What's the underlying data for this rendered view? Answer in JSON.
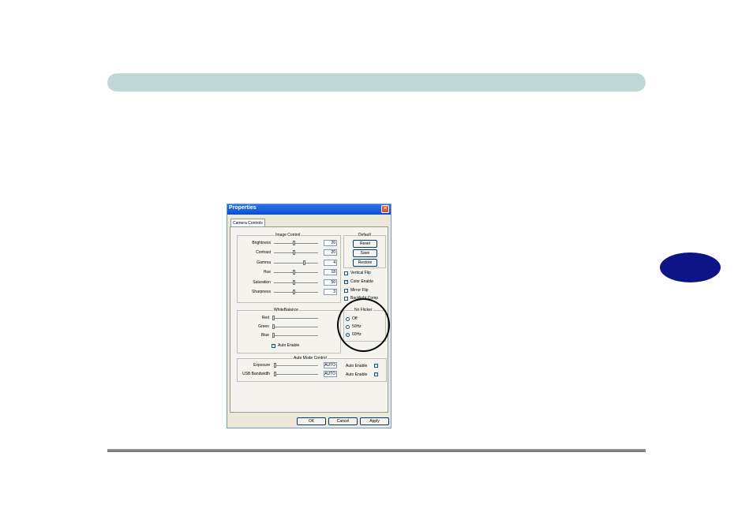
{
  "window": {
    "title": "Properties",
    "close_glyph": "✕"
  },
  "tab": {
    "label": "Camera Controls"
  },
  "image_control": {
    "title": "Image Control",
    "rows": [
      {
        "label": "Brightness",
        "value": "20",
        "level": 0.45
      },
      {
        "label": "Contrast",
        "value": "20",
        "level": 0.45
      },
      {
        "label": "Gamma",
        "value": "4",
        "level": 0.7
      },
      {
        "label": "Hue",
        "value": "18",
        "level": 0.45
      },
      {
        "label": "Saturation",
        "value": "50",
        "level": 0.45
      },
      {
        "label": "Sharpness",
        "value": "3",
        "level": 0.45
      }
    ]
  },
  "default": {
    "title": "Default",
    "reset": "Reset",
    "save": "Save",
    "restore": "Restore"
  },
  "checks": {
    "vertical_flip": {
      "label": "Vertical Flip",
      "checked": false
    },
    "color_enable": {
      "label": "Color Enable",
      "checked": true
    },
    "mirror_flip": {
      "label": "Mirror Flip",
      "checked": false
    },
    "backlight_comp": {
      "label": "Backlight Comp",
      "checked": false
    }
  },
  "white_balance": {
    "title": "WhiteBalance",
    "rows": [
      {
        "label": "Red",
        "level": 0.0
      },
      {
        "label": "Green",
        "level": 0.0
      },
      {
        "label": "Blue",
        "level": 0.0
      }
    ],
    "auto_enable": "Auto Enable"
  },
  "no_flicker": {
    "title": "No Flicker",
    "off": "Off",
    "hz50": "50Hz",
    "hz60": "60Hz",
    "selected": "60Hz"
  },
  "auto_mode": {
    "title": "Auto Mode Control",
    "exposure": {
      "label": "Exposure",
      "value": "AUTO",
      "auto_label": "Auto Enable"
    },
    "usb": {
      "label": "USB Bandwidth",
      "value": "AUTO",
      "auto_label": "Auto Enable"
    }
  },
  "buttons": {
    "ok": "OK",
    "cancel": "Cancel",
    "apply": "Apply"
  },
  "colors": {
    "banner": "#bfd8d5",
    "chapter_oval": "#0d1486",
    "titlebar": "#0a4fd0"
  }
}
